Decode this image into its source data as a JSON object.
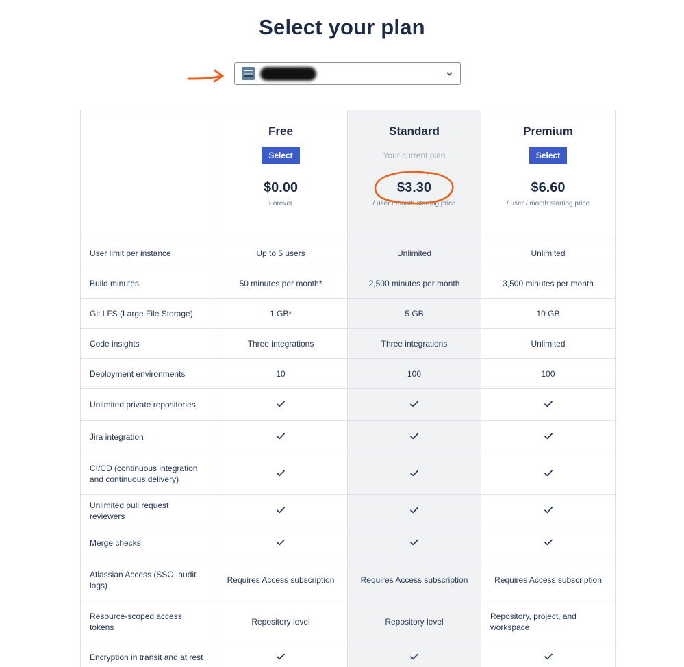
{
  "page": {
    "title": "Select your plan"
  },
  "workspace_select": {
    "selected_label": ""
  },
  "plans": [
    {
      "name": "Free",
      "action": "Select",
      "price": "$0.00",
      "price_note": "Forever"
    },
    {
      "name": "Standard",
      "action": "Your current plan",
      "price": "$3.30",
      "price_note": "/ user / month starting price"
    },
    {
      "name": "Premium",
      "action": "Select",
      "price": "$6.60",
      "price_note": "/ user / month starting price"
    }
  ],
  "features": [
    {
      "label": "User limit per instance",
      "values": [
        "Up to 5 users",
        "Unlimited",
        "Unlimited"
      ]
    },
    {
      "label": "Build minutes",
      "values": [
        "50 minutes per month*",
        "2,500 minutes per month",
        "3,500 minutes per month"
      ]
    },
    {
      "label": "Git LFS (Large File Storage)",
      "values": [
        "1 GB*",
        "5 GB",
        "10 GB"
      ]
    },
    {
      "label": "Code insights",
      "values": [
        "Three integrations",
        "Three integrations",
        "Unlimited"
      ]
    },
    {
      "label": "Deployment environments",
      "values": [
        "10",
        "100",
        "100"
      ]
    },
    {
      "label": "Unlimited private repositories",
      "values": [
        "check",
        "check",
        "check"
      ]
    },
    {
      "label": "Jira integration",
      "values": [
        "check",
        "check",
        "check"
      ]
    },
    {
      "label": "CI/CD (continuous integration and continuous delivery)",
      "values": [
        "check",
        "check",
        "check"
      ]
    },
    {
      "label": "Unlimited pull request reviewers",
      "values": [
        "check",
        "check",
        "check"
      ]
    },
    {
      "label": "Merge checks",
      "values": [
        "check",
        "check",
        "check"
      ]
    },
    {
      "label": "Atlassian Access (SSO, audit logs)",
      "values": [
        "Requires Access subscription",
        "Requires Access subscription",
        "Requires Access subscription"
      ]
    },
    {
      "label": "Resource-scoped access tokens",
      "values": [
        "Repository level",
        "Repository level",
        "Repository, project, and workspace"
      ]
    },
    {
      "label": "Encryption in transit and at rest",
      "values": [
        "check",
        "check",
        "check"
      ]
    }
  ],
  "icons": {
    "check": "check-icon",
    "chevron": "chevron-down-icon",
    "workspace": "workspace-avatar-icon"
  },
  "colors": {
    "primary_button": "#3c5ac9",
    "annotation": "#e8641e",
    "title": "#1f2a44"
  }
}
